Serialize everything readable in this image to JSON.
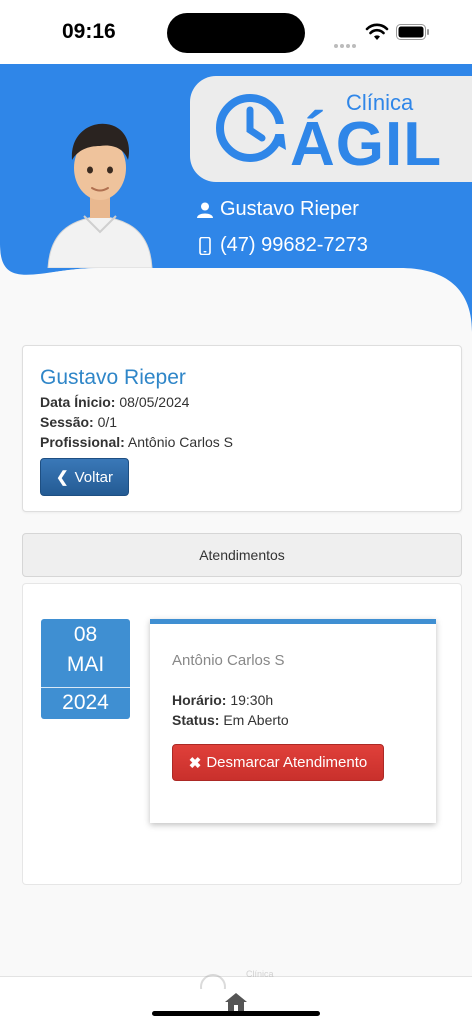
{
  "status_bar": {
    "time": "09:16",
    "icons": [
      "signal-icon",
      "wifi-icon",
      "battery-icon"
    ]
  },
  "header": {
    "logo": {
      "small_text": "Clínica",
      "big_text": "ÁGIL"
    },
    "user_name": "Gustavo Rieper",
    "phone": "(47) 99682-7273",
    "colors": {
      "brand_blue": "#2f86e8",
      "logo_bg": "#ececec"
    }
  },
  "info_card": {
    "patient_name": "Gustavo Rieper",
    "start_date_label": "Data Ínicio:",
    "start_date": "08/05/2024",
    "session_label": "Sessão:",
    "session": "0/1",
    "professional_label": "Profissional:",
    "professional": "Antônio Carlos S",
    "back_button": "Voltar"
  },
  "appointments": {
    "section_title": "Atendimentos",
    "items": [
      {
        "day": "08",
        "month": "MAI",
        "year": "2024",
        "professional": "Antônio Carlos S",
        "time_label": "Horário:",
        "time": "19:30h",
        "status_label": "Status:",
        "status": "Em Aberto",
        "cancel_button": "Desmarcar Atendimento"
      }
    ]
  },
  "footer": {
    "logo_text": "Clínica",
    "home_icon": "home-icon"
  }
}
